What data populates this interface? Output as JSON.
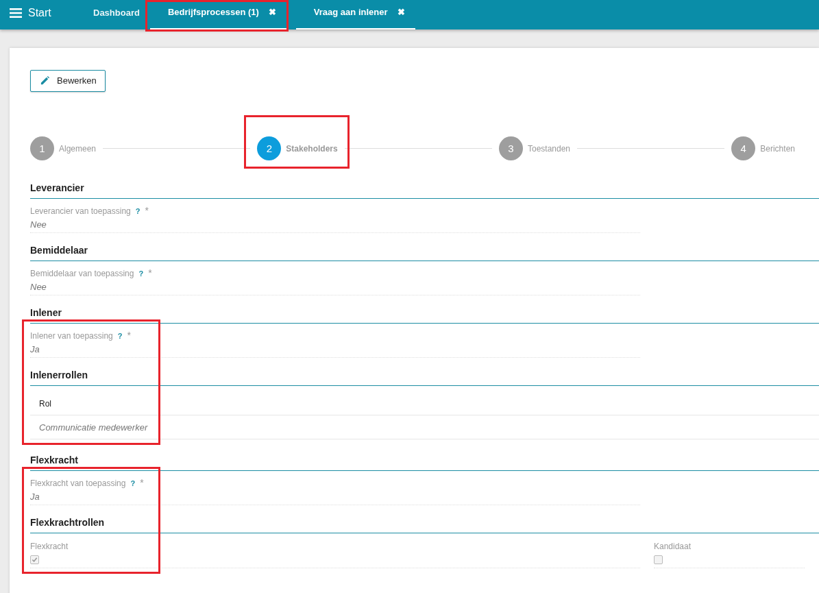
{
  "topbar": {
    "menu_label": "Start",
    "tabs": [
      {
        "label": "Dashboard",
        "selected": false,
        "highlighted": false
      },
      {
        "label": "Bedrijfsprocessen (1)",
        "close_icon": "✖",
        "selected": true,
        "highlighted": true
      },
      {
        "label": "Vraag aan inlener",
        "close_icon": "✖",
        "selected": true,
        "highlighted": false
      }
    ]
  },
  "edit_button": {
    "label": "Bewerken"
  },
  "steps": [
    {
      "number": "1",
      "label": "Algemeen",
      "selected": false,
      "highlighted": false
    },
    {
      "number": "2",
      "label": "Stakeholders",
      "selected": true,
      "highlighted": true
    },
    {
      "number": "3",
      "label": "Toestanden",
      "selected": false,
      "highlighted": false
    },
    {
      "number": "4",
      "label": "Berichten",
      "selected": false,
      "highlighted": false
    }
  ],
  "blocks": [
    {
      "kind": "heading",
      "title": "Leverancier"
    },
    {
      "kind": "field",
      "label": "Leverancier van toepassing",
      "help": "?",
      "required": "*",
      "value": "Nee"
    },
    {
      "kind": "heading",
      "title": "Bemiddelaar"
    },
    {
      "kind": "field",
      "label": "Bemiddelaar van toepassing",
      "help": "?",
      "required": "*",
      "value": "Nee"
    },
    {
      "kind": "heading",
      "title": "Inlener"
    },
    {
      "kind": "group",
      "highlighted": true,
      "blocks": [
        {
          "kind": "field",
          "label": "Inlener van toepassing",
          "help": "?",
          "required": "*",
          "value": "Ja"
        },
        {
          "kind": "heading",
          "title": "Inlenerrollen"
        },
        {
          "kind": "table",
          "columns": [
            "Rol"
          ],
          "rows": [
            [
              "Communicatie medewerker"
            ]
          ]
        }
      ]
    },
    {
      "kind": "heading",
      "title": "Flexkracht"
    },
    {
      "kind": "group",
      "highlighted": true,
      "blocks": [
        {
          "kind": "field",
          "label": "Flexkracht van toepassing",
          "help": "?",
          "required": "*",
          "value": "Ja"
        },
        {
          "kind": "heading",
          "title": "Flexkrachtrollen"
        },
        {
          "kind": "checkboxes",
          "options": [
            {
              "label": "Flexkracht",
              "checked": true
            },
            {
              "label": "Kandidaat",
              "checked": false
            }
          ]
        }
      ]
    }
  ]
}
